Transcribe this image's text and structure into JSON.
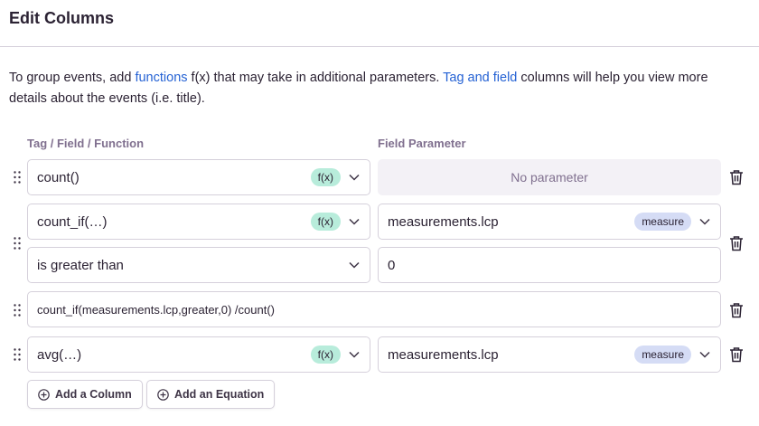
{
  "dialog": {
    "title": "Edit Columns",
    "description": {
      "part1": "To group events, add ",
      "link1": "functions",
      "part2": " f(x) that may take in additional parameters. ",
      "link2": "Tag and field",
      "part3": " columns will help you view more details about the events (i.e. title)."
    }
  },
  "headers": {
    "function": "Tag / Field / Function",
    "parameter": "Field Parameter"
  },
  "rows": [
    {
      "function": "count()",
      "function_tag": "f(x)",
      "parameter_placeholder": "No parameter"
    },
    {
      "function": "count_if(…)",
      "function_tag": "f(x)",
      "parameter": "measurements.lcp",
      "parameter_tag": "measure",
      "operator": "is greater than",
      "value": "0"
    },
    {
      "equation": "count_if(measurements.lcp,greater,0) /count()"
    },
    {
      "function": "avg(…)",
      "function_tag": "f(x)",
      "parameter": "measurements.lcp",
      "parameter_tag": "measure"
    }
  ],
  "actions": {
    "add_column": "Add a Column",
    "add_equation": "Add an Equation"
  },
  "colors": {
    "link": "#2562d4",
    "fx_tag": "#b8ecdb",
    "measure_tag": "#d5dcf5",
    "border": "#d5d0db",
    "empty_bg": "#f3f1f6"
  }
}
